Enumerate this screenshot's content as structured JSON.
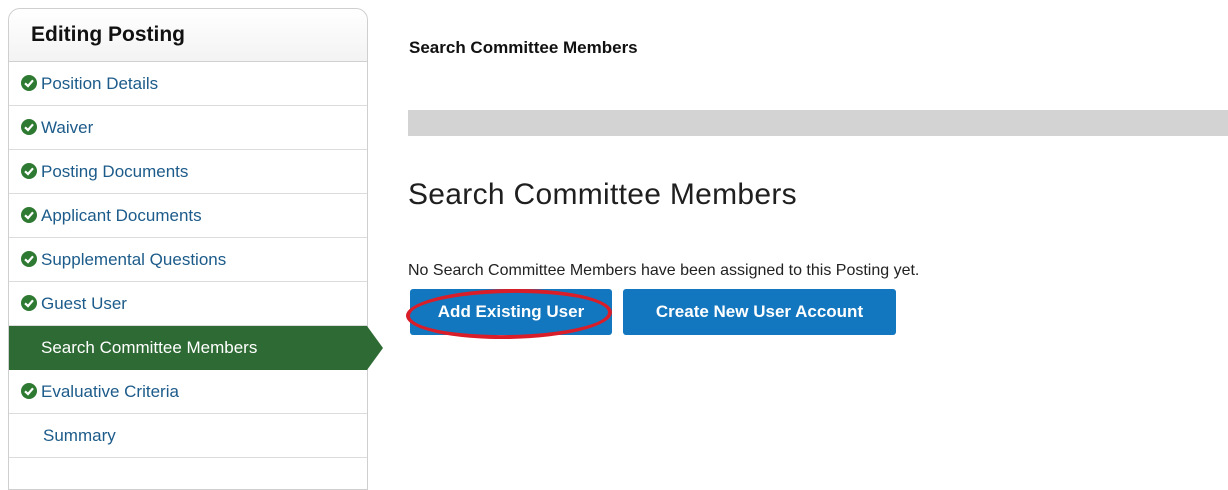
{
  "sidebar": {
    "header": "Editing Posting",
    "items": [
      {
        "label": "Position Details",
        "complete": true,
        "active": false
      },
      {
        "label": "Waiver",
        "complete": true,
        "active": false
      },
      {
        "label": "Posting Documents",
        "complete": true,
        "active": false
      },
      {
        "label": "Applicant Documents",
        "complete": true,
        "active": false
      },
      {
        "label": "Supplemental Questions",
        "complete": true,
        "active": false
      },
      {
        "label": "Guest User",
        "complete": true,
        "active": false
      },
      {
        "label": "Search Committee Members",
        "complete": false,
        "active": true
      },
      {
        "label": "Evaluative Criteria",
        "complete": true,
        "active": false
      },
      {
        "label": "Summary",
        "complete": false,
        "active": false
      }
    ]
  },
  "main": {
    "page_title": "Search Committee Members",
    "section_heading": "Search Committee Members",
    "empty_message": "No Search Committee Members have been assigned to this Posting yet.",
    "buttons": {
      "add_existing": "Add Existing User",
      "create_new": "Create New User Account"
    }
  },
  "colors": {
    "active_nav": "#2e6a33",
    "check_icon": "#2f7a32",
    "link": "#1c5b8a",
    "button": "#1277bf",
    "highlight_ring": "#d91e2a"
  }
}
